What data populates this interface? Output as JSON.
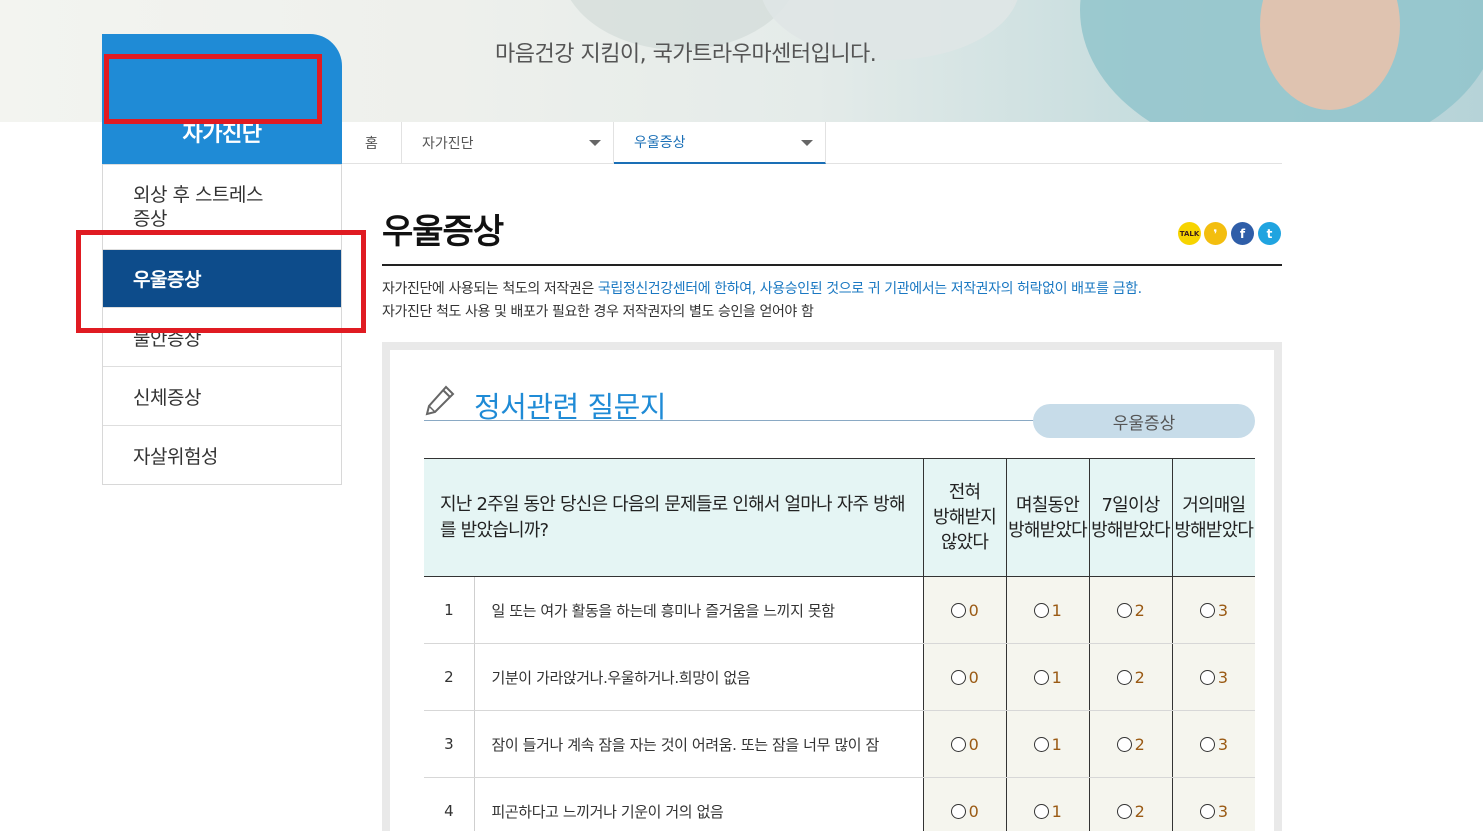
{
  "hero": {
    "tagline": "마음건강 지킴이, 국가트라우마센터입니다."
  },
  "sidebar": {
    "title": "자가진단",
    "items": [
      {
        "label": "외상 후 스트레스\n증상"
      },
      {
        "label": "우울증상",
        "active": true
      },
      {
        "label": "불안증상"
      },
      {
        "label": "신체증상"
      },
      {
        "label": "자살위험성"
      }
    ]
  },
  "breadcrumb": {
    "home": "홈",
    "level1": "자가진단",
    "level2": "우울증상"
  },
  "page": {
    "title": "우울증상",
    "share": [
      "kakaotalk-icon",
      "kakaostory-icon",
      "facebook-icon",
      "twitter-icon"
    ],
    "notice_line1_a": "자가진단에 사용되는 척도의 저작권은 ",
    "notice_line1_b": "국립정신건강센터에 한하여, 사용승인된 것으로 귀 기관에서는 저작권자의 허락없이 배포를 금함.",
    "notice_line2": "자가진단 척도 사용 및 배포가 필요한 경우 저작권자의 별도 승인을 얻어야 함"
  },
  "questionnaire": {
    "title": "정서관련 질문지",
    "tag": "우울증상",
    "question_header": "지난 2주일 동안 당신은 다음의 문제들로 인해서 얼마나 자주 방해를 받았습니까?",
    "options": [
      {
        "label": "전혀\n방해받지\n않았다",
        "score": "0"
      },
      {
        "label": "며칠동안\n방해받았다",
        "score": "1"
      },
      {
        "label": "7일이상\n방해받았다",
        "score": "2"
      },
      {
        "label": "거의매일\n방해받았다",
        "score": "3"
      }
    ],
    "rows": [
      {
        "num": "1",
        "text": "일 또는 여가 활동을 하는데 흥미나 즐거움을 느끼지 못함"
      },
      {
        "num": "2",
        "text": "기분이 가라앉거나.우울하거나.희망이 없음"
      },
      {
        "num": "3",
        "text": "잠이 들거나 계속 잠을 자는 것이 어려움. 또는 잠을 너무 많이 잠"
      },
      {
        "num": "4",
        "text": "피곤하다고 느끼거나 기운이 거의 없음"
      }
    ]
  },
  "colors": {
    "sidebar_header": "#1f8bd6",
    "sidebar_active": "#0d4c8b",
    "highlight_box": "#e01b22",
    "accent_text": "#1a78c2"
  }
}
